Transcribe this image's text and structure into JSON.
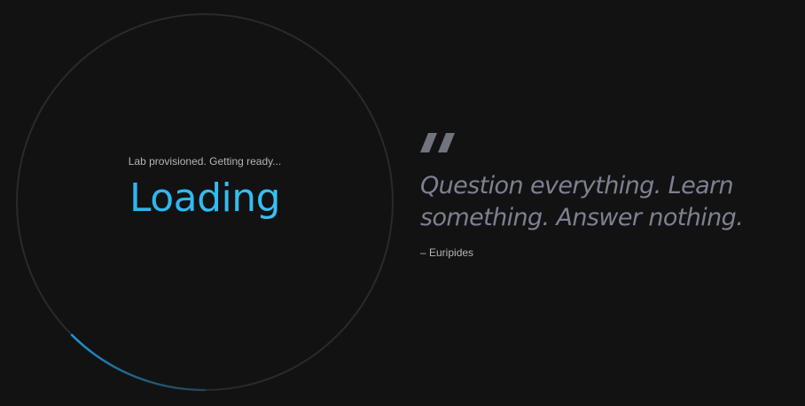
{
  "loader": {
    "status_text": "Lab provisioned. Getting ready...",
    "title": "Loading",
    "progress_arc_color": "#1c98d6",
    "track_color": "#2a2a2c",
    "progress_fraction": 0.125
  },
  "quote": {
    "icon": "quote-mark-icon",
    "text": "Question everything. Learn something. Answer nothing.",
    "author": "– Euripides",
    "color": "#7c8190"
  }
}
